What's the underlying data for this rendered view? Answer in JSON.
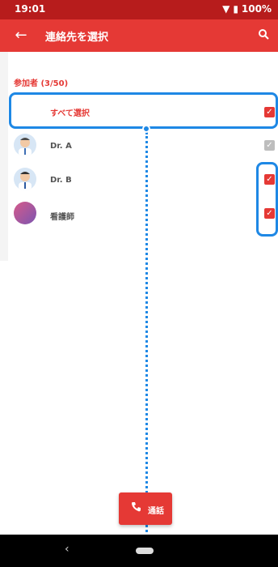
{
  "status_bar": {
    "time": "19:01",
    "battery": "100%"
  },
  "app_bar": {
    "title": "連絡先を選択",
    "back_icon": "back-arrow-icon",
    "search_icon": "search-icon"
  },
  "list": {
    "section_label": "参加者 (3/50)",
    "select_all_label": "すべて選択",
    "items": [
      {
        "label": "Dr. A",
        "checked": true,
        "enabled": false
      },
      {
        "label": "Dr. B",
        "checked": true,
        "enabled": true
      },
      {
        "label": "看護師",
        "checked": true,
        "enabled": true
      }
    ]
  },
  "call_button": {
    "label": "通話",
    "icon": "phone-icon"
  },
  "colors": {
    "status": "#b71c1c",
    "primary": "#e53935",
    "annotation": "#1e88e5"
  }
}
